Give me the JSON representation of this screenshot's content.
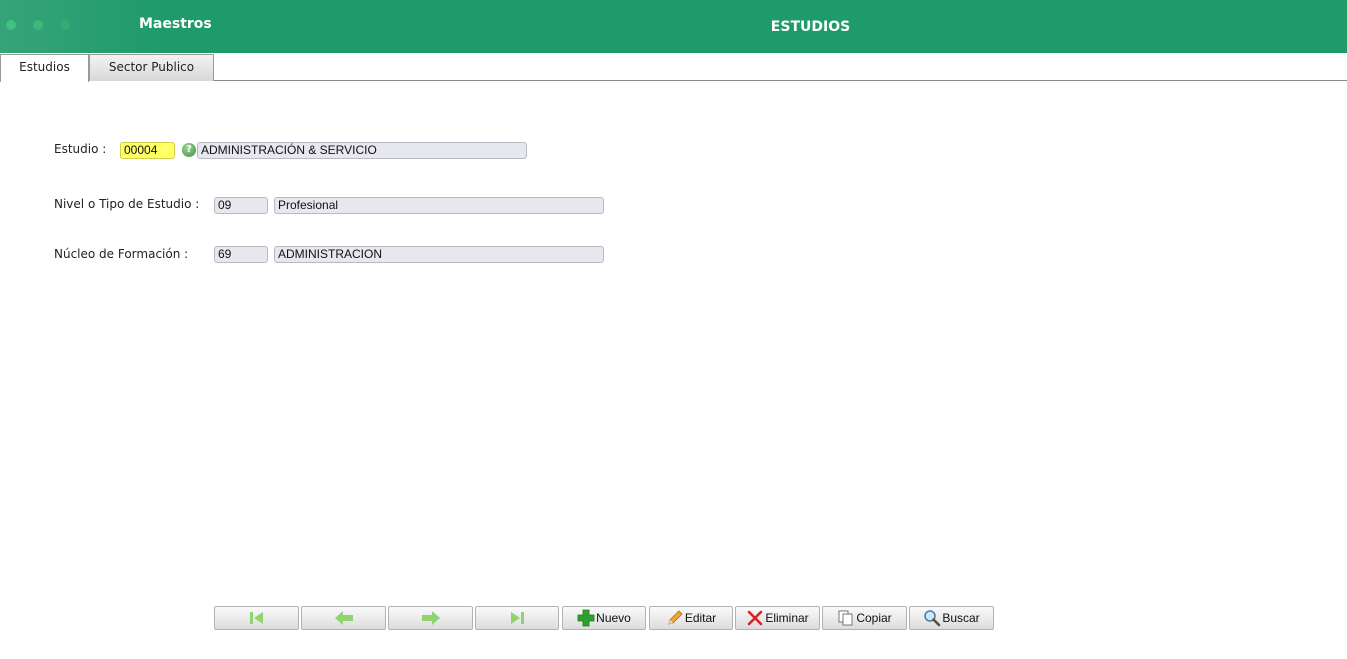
{
  "titlebar": {
    "app_title": "Maestros",
    "window_title": "ESTUDIOS",
    "color": "#1f9a6a"
  },
  "tabs": [
    {
      "label": "Estudios",
      "active": true
    },
    {
      "label": "Sector Publico",
      "active": false
    }
  ],
  "form": {
    "estudio": {
      "label": "Estudio :",
      "code": "00004",
      "description": "ADMINISTRACIÓN & SERVICIO",
      "help_icon": "help-icon"
    },
    "nivel": {
      "label": "Nivel o Tipo de Estudio :",
      "code": "09",
      "description": "Profesional"
    },
    "nucleo": {
      "label": "Núcleo de Formación :",
      "code": "69",
      "description": "ADMINISTRACION"
    }
  },
  "toolbar": {
    "first_icon": "first-record-icon",
    "prev_icon": "previous-record-icon",
    "next_icon": "next-record-icon",
    "last_icon": "last-record-icon",
    "nuevo": "Nuevo",
    "editar": "Editar",
    "eliminar": "Eliminar",
    "copiar": "Copiar",
    "buscar": "Buscar"
  }
}
